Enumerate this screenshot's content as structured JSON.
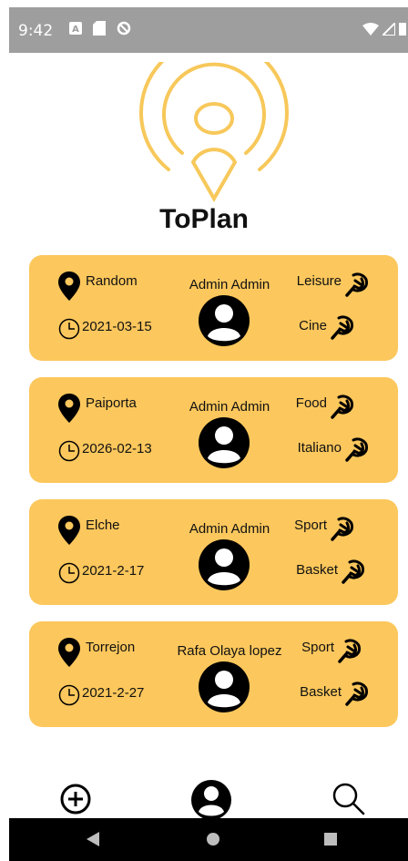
{
  "status_bar": {
    "time": "9:42",
    "icons": [
      "a-badge-icon",
      "sd-card-icon",
      "data-saver-icon"
    ],
    "right_icons": [
      "wifi-icon",
      "signal-icon",
      "battery-icon"
    ]
  },
  "app": {
    "title": "ToPlan",
    "accent_color": "#f7c85a",
    "card_color": "#fcc75c"
  },
  "plans": [
    {
      "location": "Random",
      "date": "2021-03-15",
      "owner": "Admin Admin",
      "category": "Leisure",
      "subcategory": "Cine"
    },
    {
      "location": "Paiporta",
      "date": "2026-02-13",
      "owner": "Admin Admin",
      "category": "Food",
      "subcategory": "Italiano"
    },
    {
      "location": "Elche",
      "date": "2021-2-17",
      "owner": "Admin Admin",
      "category": "Sport",
      "subcategory": "Basket"
    },
    {
      "location": "Torrejon",
      "date": "2021-2-27",
      "owner": "Rafa Olaya lopez",
      "category": "Sport",
      "subcategory": "Basket"
    }
  ],
  "bottom_nav": [
    "add-plan-icon",
    "profile-icon",
    "search-icon"
  ],
  "system_nav": [
    "back-icon",
    "home-icon",
    "recents-icon"
  ]
}
